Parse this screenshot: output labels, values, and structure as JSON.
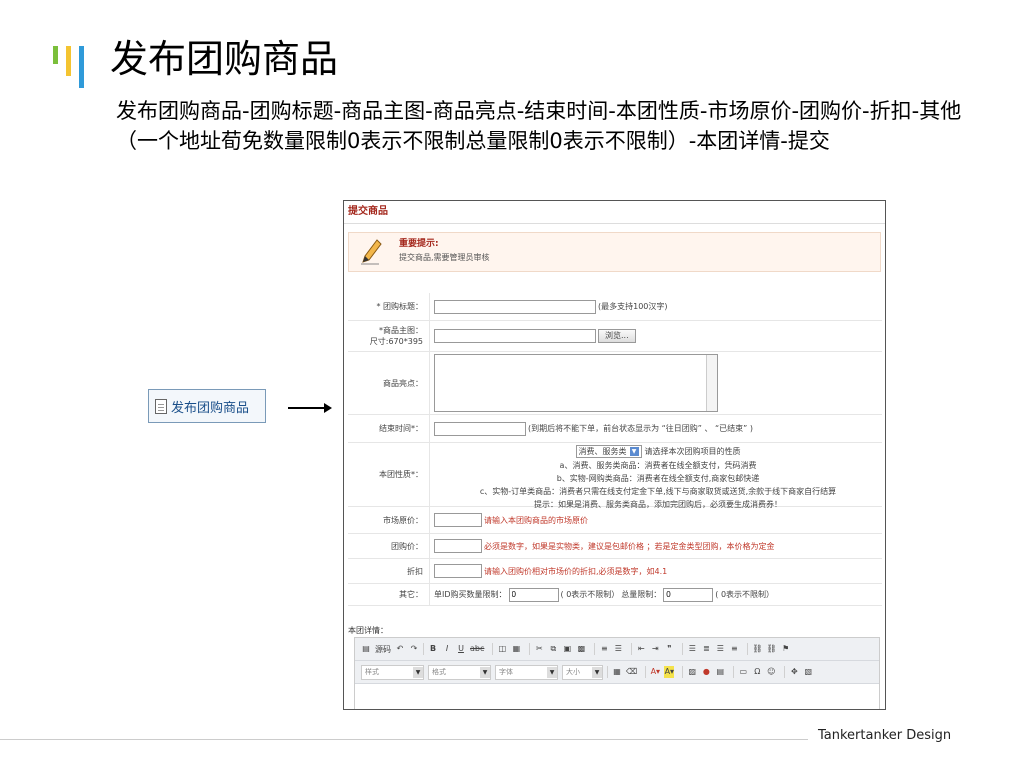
{
  "slide": {
    "title": "发布团购商品",
    "description": "发布团购商品-团购标题-商品主图-商品亮点-结束时间-本团性质-市场原价-团购价-折扣-其他（一个地址荀免数量限制0表示不限制总量限制0表示不限制）-本团详情-提交",
    "nav_label": "发布团购商品",
    "footer": "Tankertanker Design"
  },
  "colors": {
    "accent_green": "#7bbf3b",
    "accent_yellow": "#f4c431",
    "accent_blue": "#2f9ad9",
    "brand_red": "#a4281d"
  },
  "panel": {
    "header": "提交商品",
    "notice_title": "重要提示:",
    "notice_text": "提交商品,需要管理员审核",
    "fields": {
      "title_label": "* 团购标题：",
      "title_hint": "(最多支持100汉字)",
      "image_label_1": "*商品主图：",
      "image_label_2": "尺寸:670*395",
      "browse_button": "浏览...",
      "highlights_label": "商品亮点：",
      "endtime_label": "结束时间*：",
      "endtime_hint": "(到期后将不能下单，前台状态显示为 “往日团购” 、 “已结束” )",
      "nature_label": "本团性质*：",
      "nature_select": "消费、服务类",
      "nature_hint": "请选择本次团购项目的性质",
      "nature_lines": [
        "a、消费、服务类商品：消费者在线全额支付，凭码消费",
        "b、实物-网购类商品：消费者在线全额支付,商家包邮快递",
        "c、实物-订单类商品：消费者只需在线支付定金下单,线下与商家取货或送货,余款于线下商家自行结算",
        "提示：如果是消费、服务类商品，添加完团购后，必须要生成消费券！"
      ],
      "market_label": "市场原价：",
      "market_hint": "请输入本团购商品的市场原价",
      "price_label": "团购价：",
      "price_hint": "必须是数字，如果是实物类，建议是包邮价格 ；若是定金类型团购，本价格为定金",
      "discount_label": "折扣",
      "discount_hint": "请输入团购价相对市场价的折扣,必须是数字，如4.1",
      "other_label": "其它：",
      "per_id_label": "单ID购买数量限制：",
      "per_id_value": "0",
      "per_id_hint": "( 0表示不限制）",
      "total_label": "总量限制：",
      "total_value": "0",
      "total_hint": "( 0表示不限制）"
    },
    "detail_label": "本团详情：",
    "editor": {
      "source": "源码",
      "style": "样式",
      "format": "格式",
      "font": "字体",
      "size": "大小"
    }
  }
}
